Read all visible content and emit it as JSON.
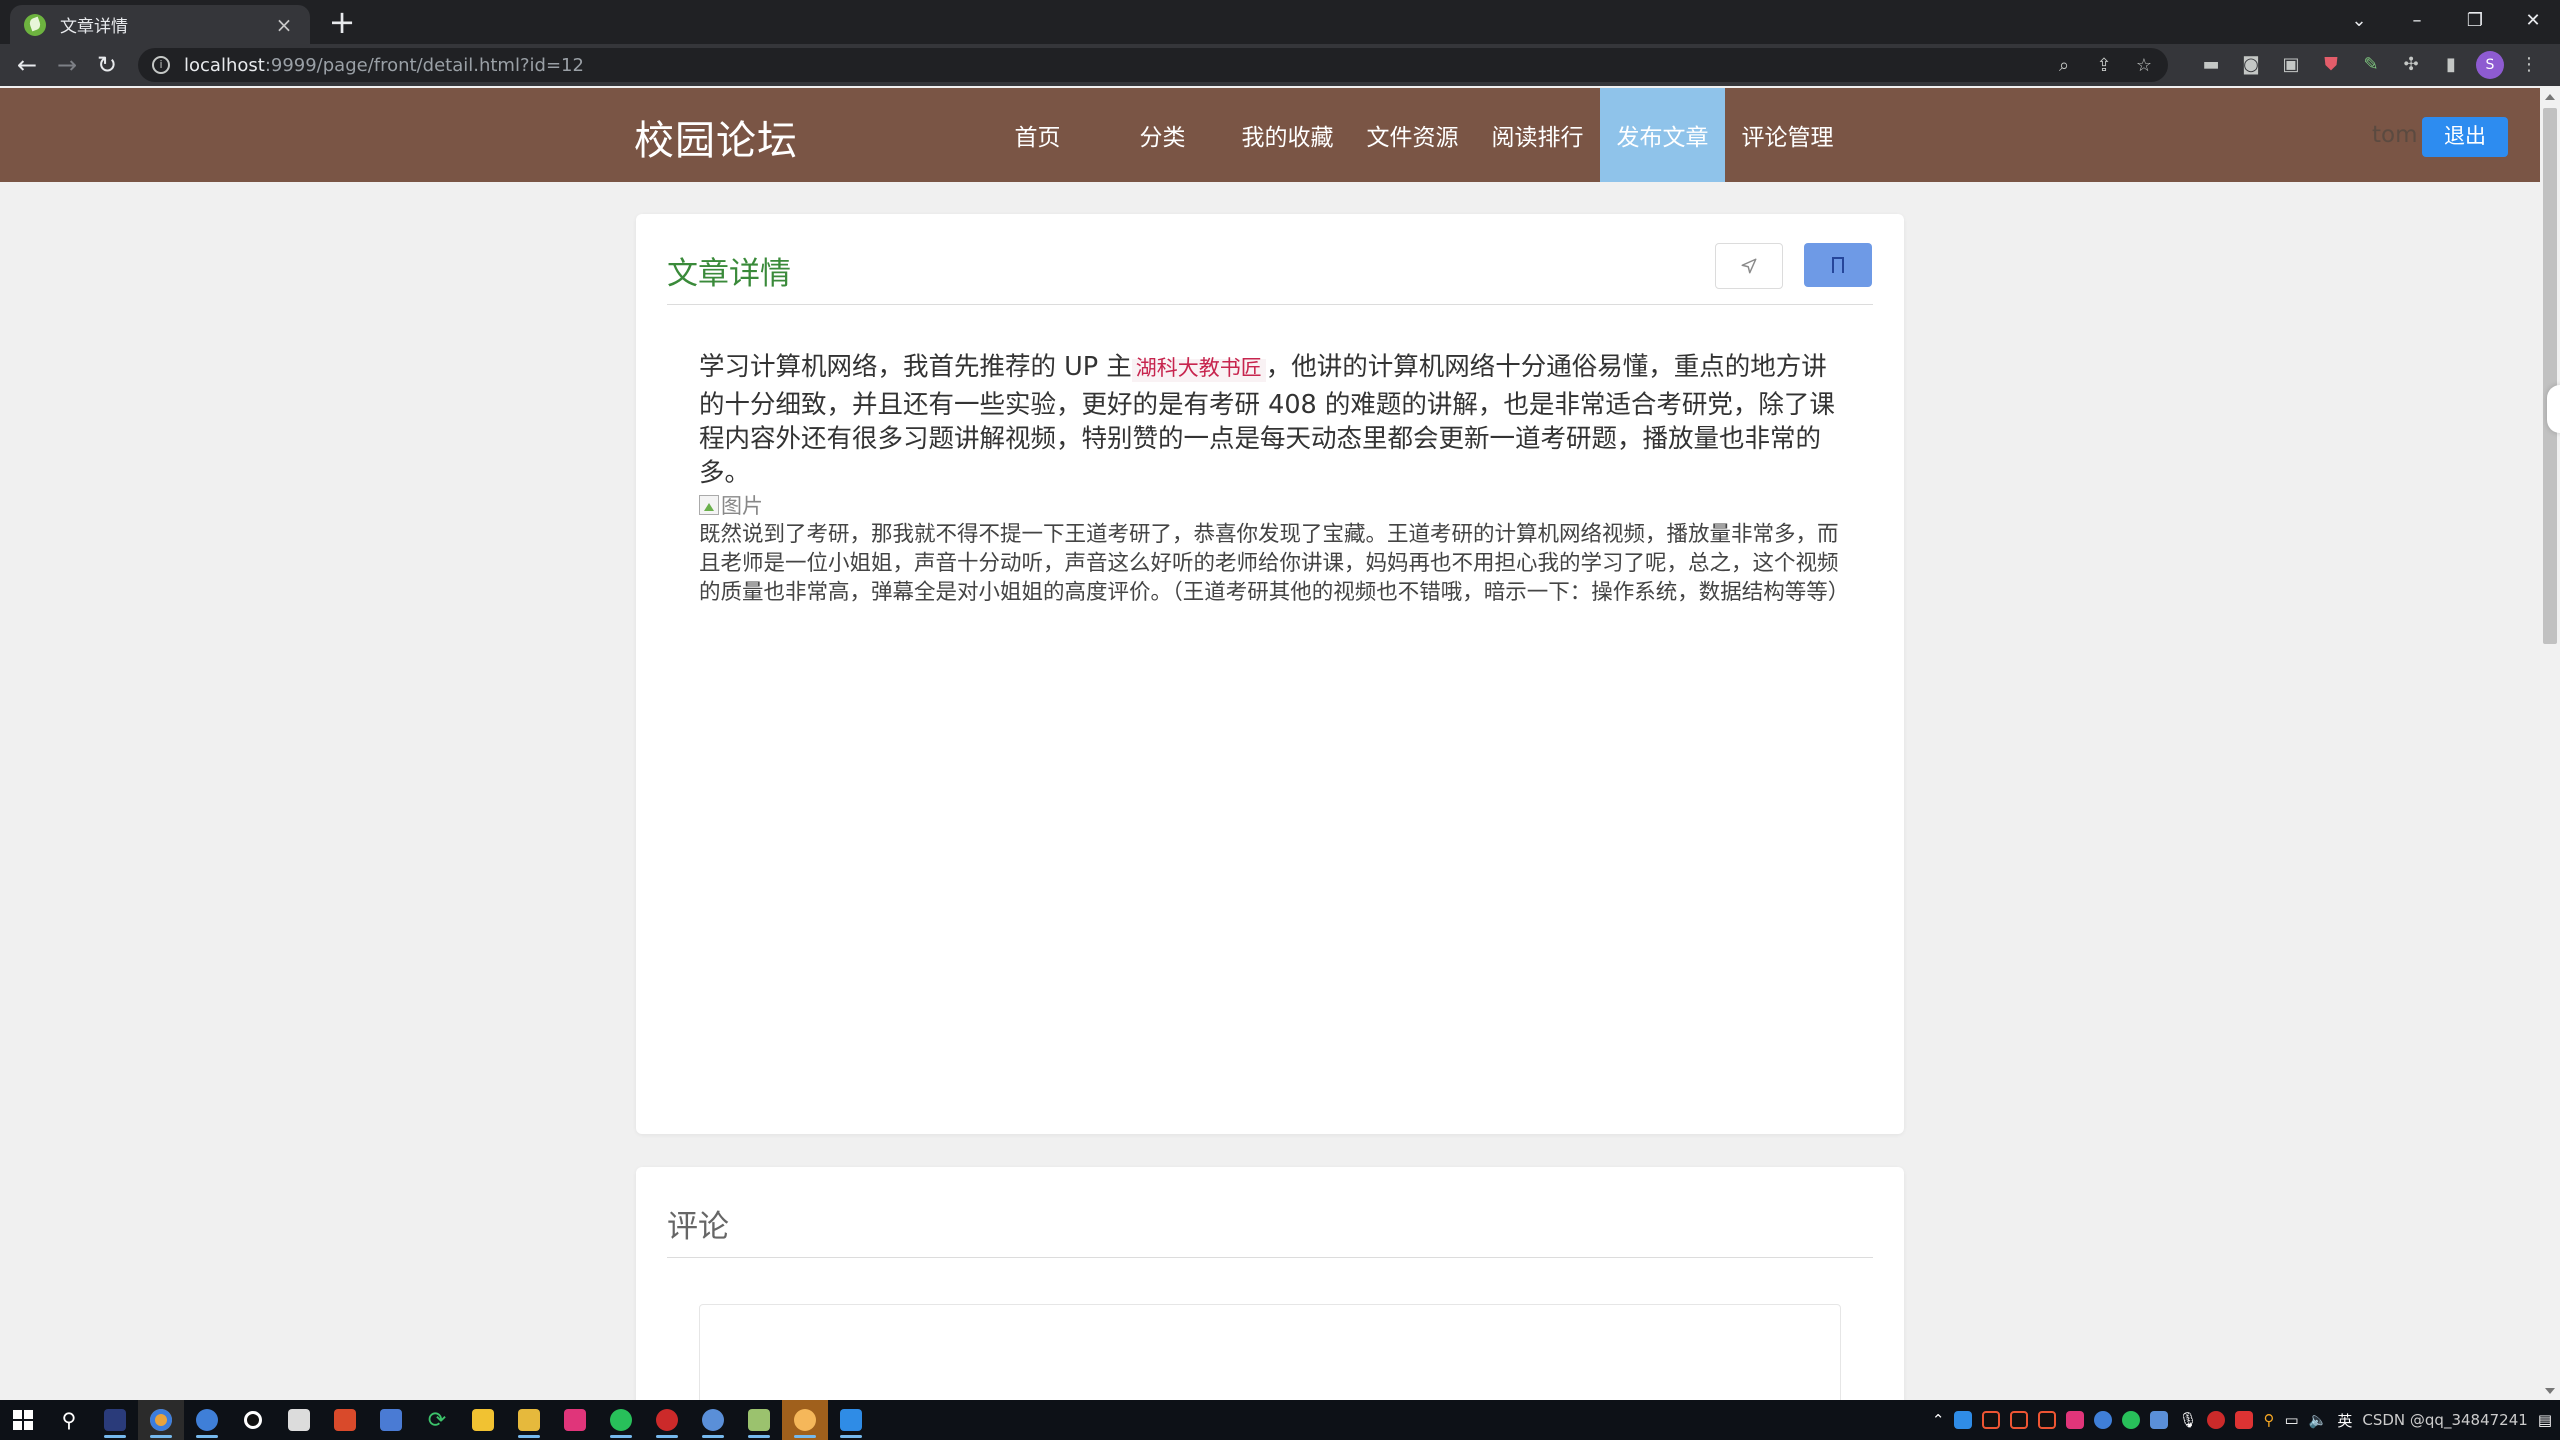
{
  "browser": {
    "tab_title": "文章详情",
    "tab_close": "×",
    "new_tab": "+",
    "url_host": "localhost",
    "url_rest": ":9999/page/front/detail.html?id=12",
    "icons": [
      "back-icon",
      "forward-icon",
      "reload-icon",
      "info-icon",
      "zoom-icon",
      "share-icon",
      "star-icon"
    ],
    "window_controls": {
      "dropdown": "⌄",
      "minimize": "–",
      "restore": "❐",
      "close": "✕"
    },
    "profile_initial": "S"
  },
  "site": {
    "logo": "校园论坛",
    "nav": [
      {
        "label": "首页",
        "active": false
      },
      {
        "label": "分类",
        "active": false
      },
      {
        "label": "我的收藏",
        "active": false
      },
      {
        "label": "文件资源",
        "active": false
      },
      {
        "label": "阅读排行",
        "active": false
      },
      {
        "label": "发布文章",
        "active": true
      },
      {
        "label": "评论管理",
        "active": false
      }
    ],
    "username": "tom",
    "logout": "退出",
    "header_color": "#7a5545",
    "active_color": "#8fc3ea",
    "accent": "#2d8cf0"
  },
  "article": {
    "heading": "文章详情",
    "para1_before": "学习计算机网络，我首先推荐的 UP 主",
    "para1_highlight": "湖科大教书匠",
    "para1_after": "，他讲的计算机网络十分通俗易懂，重点的地方讲的十分细致，并且还有一些实验，更好的是有考研 408 的难题的讲解，也是非常适合考研党，除了课程内容外还有很多习题讲解视频，特别赞的一点是每天动态里都会更新一道考研题，播放量也非常的多。",
    "image_alt": "图片",
    "para2": "既然说到了考研，那我就不得不提一下王道考研了，恭喜你发现了宝藏。王道考研的计算机网络视频，播放量非常多，而且老师是一位小姐姐，声音十分动听，声音这么好听的老师给你讲课，妈妈再也不用担心我的学习了呢，总之，这个视频的质量也非常高，弹幕全是对小姐姐的高度评价。（王道考研其他的视频也不错哦，暗示一下：操作系统，数据结构等等）"
  },
  "comments": {
    "heading": "评论"
  },
  "taskbar": {
    "tray_lang": "英",
    "tray_text": "CSDN @qq_34847241"
  }
}
